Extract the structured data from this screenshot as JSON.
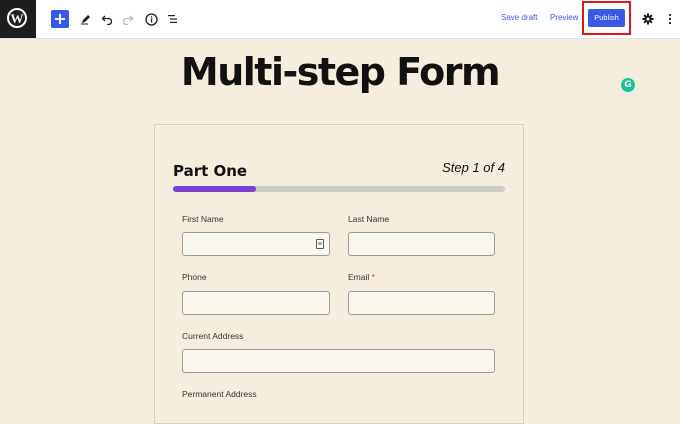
{
  "toolbar": {
    "logo_glyph": "W",
    "add_icon": "plus-icon",
    "tools_icon": "pencil-icon",
    "undo_icon": "undo-icon",
    "redo_icon": "redo-icon",
    "info_icon": "info-icon",
    "outline_icon": "list-view-icon",
    "save_draft": "Save draft",
    "preview": "Preview",
    "publish": "Publish",
    "settings_icon": "gear-icon",
    "more_icon": "more-vertical-icon",
    "accent_color": "#3858e9",
    "highlight_color": "#e1141b"
  },
  "page": {
    "title": "Multi-step Form",
    "grammarly_glyph": "G"
  },
  "form": {
    "part_title": "Part One",
    "step_label": "Step 1 of 4",
    "progress_fraction": 0.25,
    "progress_color": "#7b3fd1",
    "fields": {
      "first_name": "First Name",
      "last_name": "Last Name",
      "phone": "Phone",
      "email": "Email",
      "email_required": "*",
      "current_address": "Current Address",
      "permanent_address": "Permanent Address"
    }
  }
}
